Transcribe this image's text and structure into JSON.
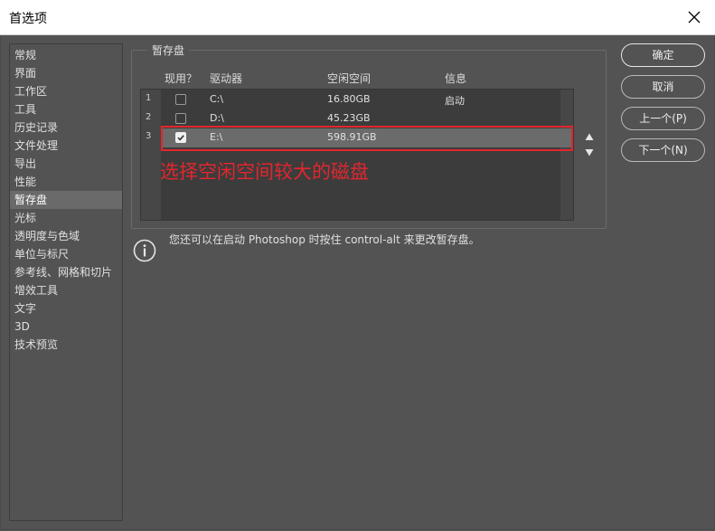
{
  "window": {
    "title": "首选项"
  },
  "sidebar": {
    "items": [
      {
        "label": "常规"
      },
      {
        "label": "界面"
      },
      {
        "label": "工作区"
      },
      {
        "label": "工具"
      },
      {
        "label": "历史记录"
      },
      {
        "label": "文件处理"
      },
      {
        "label": "导出"
      },
      {
        "label": "性能"
      },
      {
        "label": "暂存盘"
      },
      {
        "label": "光标"
      },
      {
        "label": "透明度与色域"
      },
      {
        "label": "单位与标尺"
      },
      {
        "label": "参考线、网格和切片"
      },
      {
        "label": "增效工具"
      },
      {
        "label": "文字"
      },
      {
        "label": "3D"
      },
      {
        "label": "技术预览"
      }
    ],
    "active_index": 8
  },
  "scratch": {
    "group_title": "暂存盘",
    "columns": {
      "active": "现用？",
      "drive": "驱动器",
      "free_space": "空闲空间",
      "info": "信息"
    },
    "rows": [
      {
        "num": "1",
        "checked": false,
        "drive": "C:\\",
        "free_space": "16.80GB",
        "info": "启动"
      },
      {
        "num": "2",
        "checked": false,
        "drive": "D:\\",
        "free_space": "45.23GB",
        "info": ""
      },
      {
        "num": "3",
        "checked": true,
        "drive": "E:\\",
        "free_space": "598.91GB",
        "info": ""
      }
    ],
    "selected_row": 2,
    "annotation": "选择空闲空间较大的磁盘",
    "hint": "您还可以在启动 Photoshop 时按住 control-alt 来更改暂存盘。"
  },
  "buttons": {
    "ok": "确定",
    "cancel": "取消",
    "prev": "上一个(P)",
    "next": "下一个(N)"
  },
  "colors": {
    "accent_annotation": "#e2262e",
    "panel_bg": "#535353"
  }
}
